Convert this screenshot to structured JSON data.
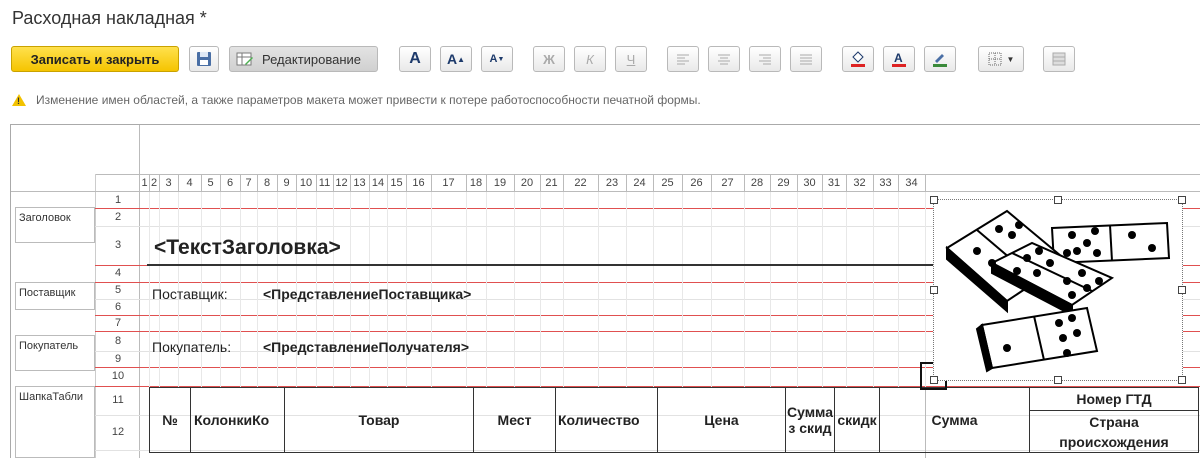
{
  "window": {
    "title": "Расходная накладная *"
  },
  "toolbar": {
    "save_close": "Записать и закрыть",
    "editing": "Редактирование",
    "bold_a": "A",
    "grow_a": "A",
    "shrink_a": "A",
    "bold": "Ж",
    "italic": "К",
    "underline": "Ч"
  },
  "warning": {
    "text": "Изменение имен областей, а также параметров макета может привести к потере работоспособности печатной формы."
  },
  "columns": [
    "1",
    "2",
    "3",
    "4",
    "5",
    "6",
    "7",
    "8",
    "9",
    "10",
    "11",
    "12",
    "13",
    "14",
    "15",
    "16",
    "17",
    "18",
    "19",
    "20",
    "21",
    "22",
    "23",
    "24",
    "25",
    "26",
    "27",
    "28",
    "29",
    "30",
    "31",
    "32",
    "33",
    "34"
  ],
  "rows": [
    "1",
    "2",
    "3",
    "4",
    "5",
    "6",
    "7",
    "8",
    "9",
    "10",
    "11",
    "12"
  ],
  "areas": [
    "Заголовок",
    "Поставщик",
    "Покупатель",
    "ШапкаТабли"
  ],
  "template": {
    "header_text": "<ТекстЗаголовка>",
    "supplier_label": "Поставщик:",
    "supplier_value": "<ПредставлениеПоставщика>",
    "buyer_label": "Покупатель:",
    "buyer_value": "<ПредставлениеПолучателя>"
  },
  "table_header": {
    "num": "№",
    "columns_col": "КолонкиКо",
    "product": "Товар",
    "places": "Мест",
    "quantity": "Количество",
    "price": "Цена",
    "sum_disc_1": "Сумма",
    "sum_disc_2": "з скид",
    "discount": "скидк",
    "sum": "Сумма",
    "gtd": "Номер ГТД",
    "country_1": "Страна",
    "country_2": "происхождения"
  }
}
